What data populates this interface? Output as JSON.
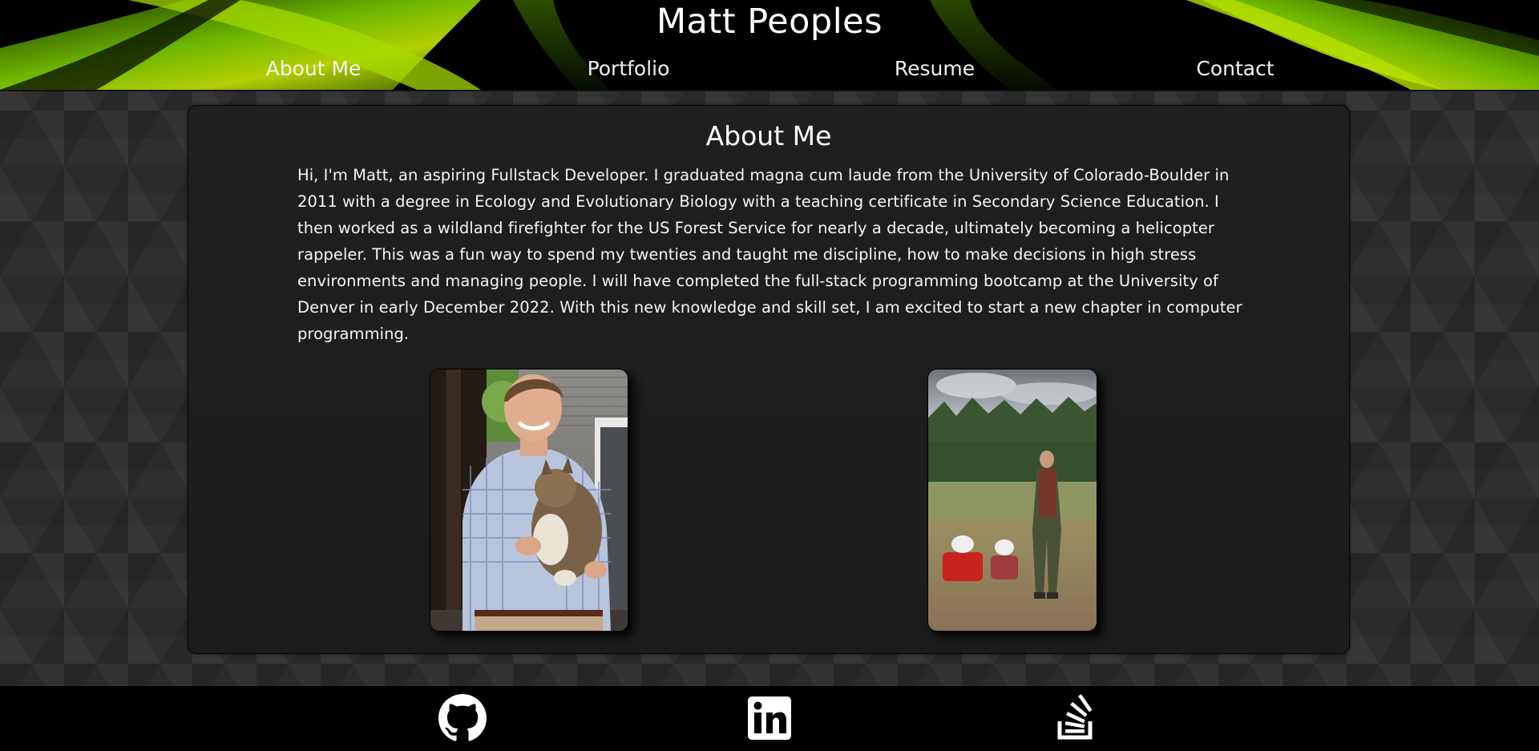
{
  "header": {
    "title": "Matt Peoples",
    "nav": [
      {
        "label": "About Me"
      },
      {
        "label": "Portfolio"
      },
      {
        "label": "Resume"
      },
      {
        "label": "Contact"
      }
    ],
    "accent_color": "#7acc00"
  },
  "about": {
    "heading": "About Me",
    "body": "Hi, I'm Matt, an aspiring Fullstack Developer. I graduated magna cum laude from the University of Colorado-Boulder in 2011 with a degree in Ecology and Evolutionary Biology with a teaching certificate in Secondary Science Education. I then worked as a wildland firefighter for the US Forest Service for nearly a decade, ultimately becoming a helicopter rappeler. This was a fun way to spend my twenties and taught me discipline, how to make decisions in high stress environments and managing people. I will have completed the full-stack programming bootcamp at the University of Denver in early December 2022. With this new knowledge and skill set, I am excited to start a new chapter in computer programming."
  },
  "footer": {
    "links": [
      {
        "icon": "github-icon"
      },
      {
        "icon": "linkedin-icon"
      },
      {
        "icon": "stackoverflow-icon"
      }
    ]
  }
}
